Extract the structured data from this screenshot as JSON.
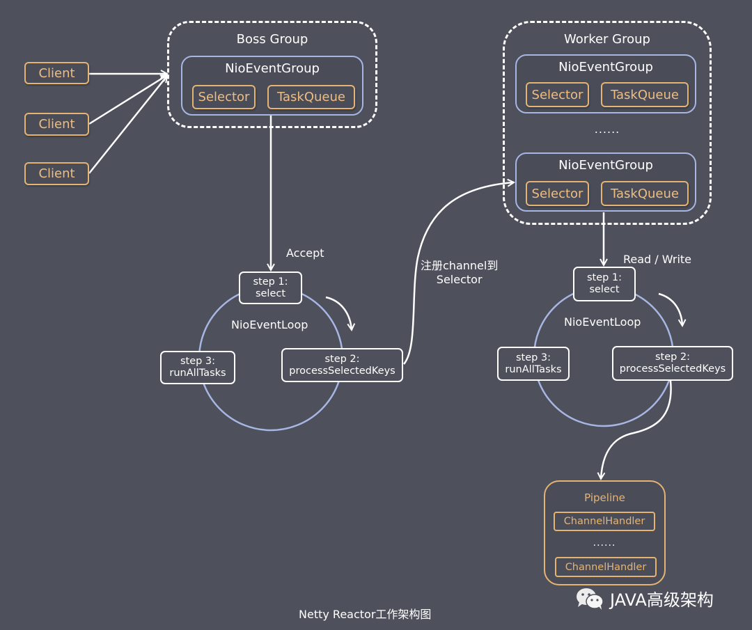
{
  "diagram": {
    "title": "Netty Reactor工作架构图",
    "watermark": {
      "icon": "wechat-icon",
      "text": "JAVA高级架构"
    },
    "colors": {
      "background": "#4e515c",
      "group_border": "#ffffff",
      "event_group_border": "#a8b6e4",
      "component_border": "#e6b472",
      "component_text": "#eebd82",
      "text": "#ffffff"
    },
    "clients": [
      {
        "label": "Client"
      },
      {
        "label": "Client"
      },
      {
        "label": "Client"
      }
    ],
    "boss_group": {
      "title": "Boss Group",
      "event_groups": [
        {
          "title": "NioEventGroup",
          "selector": "Selector",
          "task_queue": "TaskQueue"
        }
      ]
    },
    "worker_group": {
      "title": "Worker Group",
      "event_groups": [
        {
          "title": "NioEventGroup",
          "selector": "Selector",
          "task_queue": "TaskQueue"
        },
        {
          "title": "NioEventGroup",
          "selector": "Selector",
          "task_queue": "TaskQueue"
        }
      ],
      "ellipsis": "......"
    },
    "edges": {
      "accept": "Accept",
      "register": {
        "line1": "注册channel到",
        "line2": "Selector"
      },
      "read_write": "Read / Write"
    },
    "boss_loop": {
      "title": "NioEventLoop",
      "step1": {
        "line1": "step 1:",
        "line2": "select"
      },
      "step2": {
        "line1": "step 2:",
        "line2": "processSelectedKeys"
      },
      "step3": {
        "line1": "step 3:",
        "line2": "runAllTasks"
      }
    },
    "worker_loop": {
      "title": "NioEventLoop",
      "step1": {
        "line1": "step 1:",
        "line2": "select"
      },
      "step2": {
        "line1": "step 2:",
        "line2": "processSelectedKeys"
      },
      "step3": {
        "line1": "step 3:",
        "line2": "runAllTasks"
      }
    },
    "pipeline": {
      "title": "Pipeline",
      "handlers": [
        "ChannelHandler",
        "ChannelHandler"
      ],
      "ellipsis": "......"
    }
  }
}
